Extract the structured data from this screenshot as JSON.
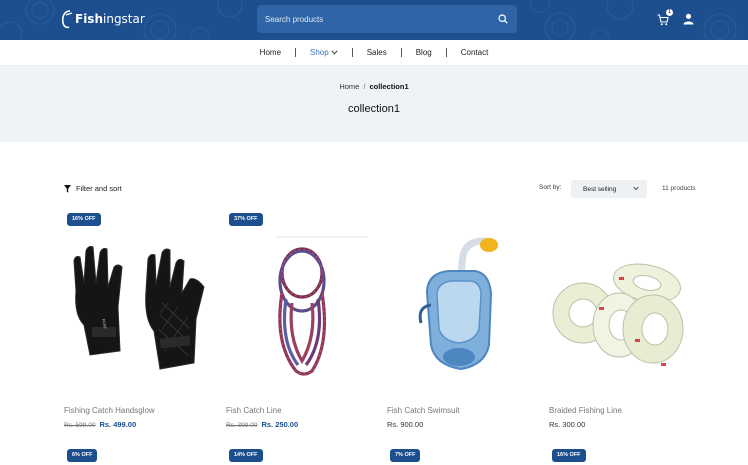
{
  "header": {
    "logo_bold": "Fish",
    "logo_light": "ingstar",
    "search_placeholder": "Search products",
    "cart_count": "1"
  },
  "nav": {
    "items": [
      {
        "label": "Home"
      },
      {
        "label": "Shop"
      },
      {
        "label": "Sales"
      },
      {
        "label": "Blog"
      },
      {
        "label": "Contact"
      }
    ]
  },
  "banner": {
    "breadcrumb_home": "Home",
    "breadcrumb_sep": "/",
    "breadcrumb_current": "collection1",
    "title": "collection1"
  },
  "toolbar": {
    "filter_label": "Filter and sort",
    "sort_label": "Sort by:",
    "sort_value": "Best selling",
    "product_count": "11 products"
  },
  "products": [
    {
      "badge": "16% OFF",
      "name": "Fishing Catch Handsglow",
      "old_price": "Rs. 599.00",
      "price": "Rs. 499.00",
      "icon": "gloves"
    },
    {
      "badge": "37% OFF",
      "name": "Fish Catch Line",
      "old_price": "Rs. 399.00",
      "price": "Rs. 250.00",
      "icon": "rope-coil"
    },
    {
      "badge": "",
      "name": "Fish Catch Swimsuit",
      "old_price": "",
      "price": "Rs. 900.00",
      "icon": "snorkel-mask"
    },
    {
      "badge": "",
      "name": "Braided Fishing Line",
      "old_price": "",
      "price": "Rs. 300.00",
      "icon": "tape-rolls"
    }
  ],
  "next_row_badges": [
    "6% OFF",
    "14% OFF",
    "7% OFF",
    "16% OFF"
  ],
  "colors": {
    "brand": "#1d4f8e",
    "banner_bg": "#eef4f6",
    "nav_active": "#3a73b8"
  }
}
